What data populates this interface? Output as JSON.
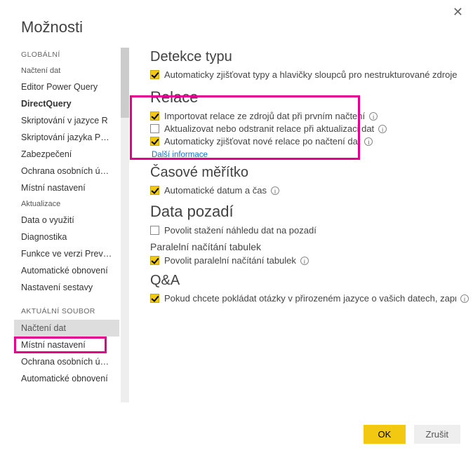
{
  "dialog": {
    "title": "Možnosti"
  },
  "sidebar": {
    "group_global": "GLOBÁLNÍ",
    "group_current": "AKTUÁLNÍ SOUBOR",
    "global_items": [
      "Načtení dat",
      "Editor Power Query",
      "DirectQuery",
      "Skriptování v jazyce R",
      "Skriptování jazyka Python",
      "Zabezpečení",
      "Ochrana osobních údajů",
      "Místní nastavení",
      "Aktualizace",
      "Data o využití",
      "Diagnostika",
      "Funkce ve verzi Preview",
      "Automatické obnovení",
      "Nastavení sestavy"
    ],
    "current_items": [
      "Načtení dat",
      "Místní nastavení",
      "Ochrana osobních údajů",
      "Automatické obnovení"
    ]
  },
  "main": {
    "type_detection": {
      "heading": "Detekce typu",
      "opt1": "Automaticky zjišťovat typy a hlavičky sloupců pro nestrukturované zdroje"
    },
    "relations": {
      "heading": "Relace",
      "opt1": "Importovat relace ze zdrojů dat při prvním načtení",
      "opt2": "Aktualizovat nebo odstranit relace při aktualizaci dat",
      "opt3": "Automaticky zjišťovat nové relace po načtení dat",
      "more": "Další informace"
    },
    "time": {
      "heading": "Časové měřítko",
      "opt1": "Automatické datum a čas"
    },
    "background": {
      "heading": "Data pozadí",
      "opt1": "Povolit stažení náhledu dat na pozadí"
    },
    "parallel": {
      "heading": "Paralelní načítání tabulek",
      "opt1": "Povolit paralelní načítání tabulek"
    },
    "qa": {
      "heading": "Q&A",
      "opt1": "Pokud chcete pokládat otázky v přirozeném jazyce o vašich datech, zapněte funkci Q&A"
    }
  },
  "footer": {
    "ok": "OK",
    "cancel": "Zrušit"
  }
}
